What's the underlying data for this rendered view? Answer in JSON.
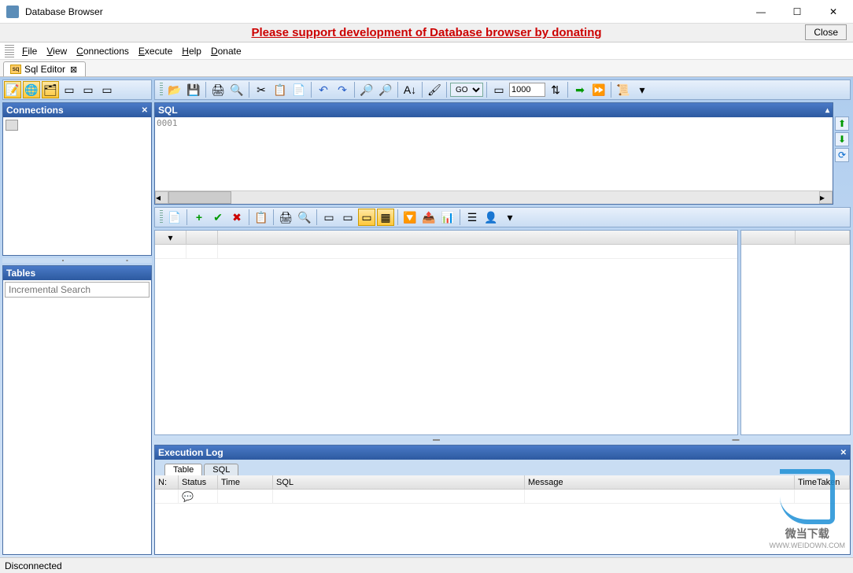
{
  "window": {
    "title": "Database Browser"
  },
  "banner": {
    "message": "Please support development of Database browser by donating",
    "close": "Close"
  },
  "menu": {
    "file": "File",
    "view": "View",
    "connections": "Connections",
    "execute": "Execute",
    "help": "Help",
    "donate": "Donate"
  },
  "editorTab": {
    "label": "Sql Editor"
  },
  "toolbar": {
    "go_label": "GO",
    "limit_value": "1000"
  },
  "panels": {
    "connections": "Connections",
    "tables": "Tables",
    "sql": "SQL",
    "execlog": "Execution Log"
  },
  "tablesSearch": {
    "placeholder": "Incremental Search"
  },
  "sqlEditor": {
    "lineLabel": "0001",
    "content": ""
  },
  "execLog": {
    "tabs": {
      "table": "Table",
      "sql": "SQL"
    },
    "columns": {
      "n": "N:",
      "status": "Status",
      "time": "Time",
      "sql": "SQL",
      "message": "Message",
      "timetaken": "TimeTaken"
    }
  },
  "status": {
    "text": "Disconnected"
  },
  "watermark": {
    "line1": "微当下载",
    "line2": "WWW.WEIDOWN.COM"
  }
}
